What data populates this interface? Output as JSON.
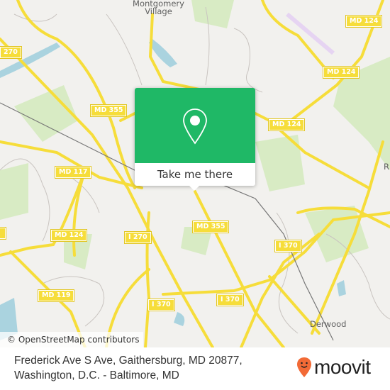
{
  "map": {
    "places": [
      {
        "name": "Montgomery\nVillage",
        "line1": "Montgomery",
        "line2": "Village"
      },
      {
        "name": "Derwood"
      },
      {
        "name": "R"
      }
    ],
    "shields": [
      "270",
      "MD 124",
      "MD 124",
      "MD 355",
      "MD 124",
      "MD 117",
      "MD 355",
      "MD 124",
      "I 270",
      "I 370",
      "MD 119",
      "I 370",
      "I 370",
      ""
    ],
    "colors": {
      "road": "#f6dd3a",
      "park": "#d8ebc4",
      "water": "#aad3df",
      "land": "#f2f1ee",
      "rail": "#777777"
    },
    "attribution": "© OpenStreetMap contributors"
  },
  "popup": {
    "icon": "map-pin-icon",
    "button_label": "Take me there",
    "color": "#1fb866"
  },
  "footer": {
    "address_line1": "Frederick Ave S Ave, Gaithersburg, MD 20877,",
    "address_line2": "Washington, D.C. - Baltimore, MD",
    "logo_text": "moovit",
    "logo_color": "#f26a36"
  }
}
